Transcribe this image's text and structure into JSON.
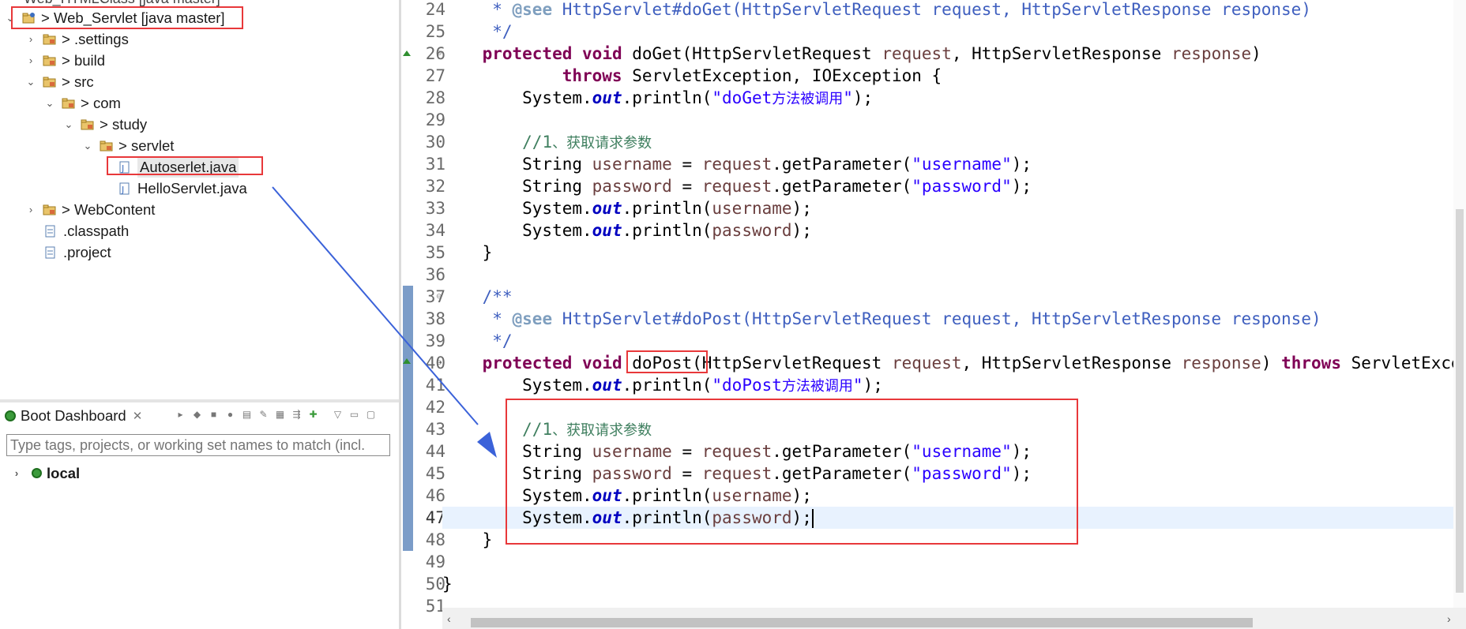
{
  "explorer": {
    "cutoff_item": "Web_HTMLClass [java master]",
    "items": [
      {
        "label": "> Web_Servlet [java master]",
        "expanded": true,
        "icon": "project-icon"
      },
      {
        "label": "> .settings",
        "expanded": false,
        "icon": "folder-icon"
      },
      {
        "label": "> build",
        "expanded": false,
        "icon": "folder-icon"
      },
      {
        "label": "> src",
        "expanded": true,
        "icon": "folder-icon"
      },
      {
        "label": "> com",
        "expanded": true,
        "icon": "package-icon"
      },
      {
        "label": "> study",
        "expanded": true,
        "icon": "package-icon"
      },
      {
        "label": "> servlet",
        "expanded": true,
        "icon": "package-icon"
      },
      {
        "label": "Autoserlet.java",
        "icon": "java-file-icon",
        "selected": true
      },
      {
        "label": "HelloServlet.java",
        "icon": "java-file-icon"
      },
      {
        "label": "> WebContent",
        "expanded": false,
        "icon": "folder-icon"
      },
      {
        "label": ".classpath",
        "icon": "file-icon"
      },
      {
        "label": ".project",
        "icon": "file-icon"
      }
    ]
  },
  "boot_dashboard": {
    "tab_label": "Boot Dashboard",
    "close_glyph": "✕",
    "filter_placeholder": "Type tags, projects, or working set names to match (incl.",
    "local_label": "local"
  },
  "editor": {
    "line_numbers": [
      "24",
      "25",
      "26",
      "27",
      "28",
      "29",
      "30",
      "31",
      "32",
      "33",
      "34",
      "35",
      "36",
      "37",
      "38",
      "39",
      "40",
      "41",
      "42",
      "43",
      "44",
      "45",
      "46",
      "47",
      "48",
      "49",
      "50",
      "51"
    ],
    "current_line": "47",
    "colors": {
      "keyword": "#7f0055",
      "string": "#2a00ff",
      "comment": "#3f7f5f",
      "javadoc": "#3f5fbf",
      "annotation_box": "#e8383a",
      "arrow": "#3b62d9"
    }
  }
}
